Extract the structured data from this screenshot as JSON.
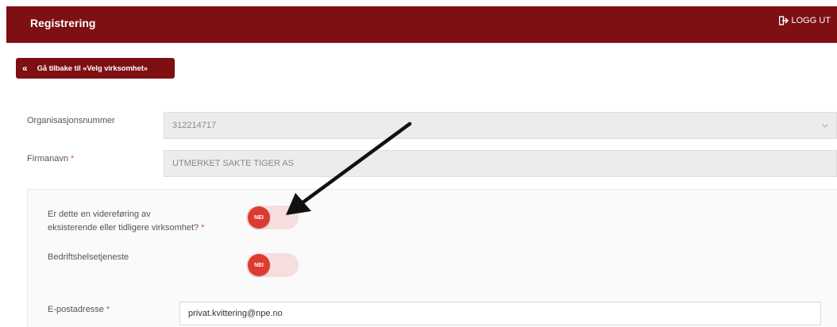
{
  "header": {
    "title": "Registrering",
    "logout_label": "LOGG UT"
  },
  "back_button": {
    "label": "Gå tilbake til «Velg virksomhet»"
  },
  "form": {
    "org_number": {
      "label": "Organisasjonsnummer",
      "value": "312214717"
    },
    "company_name": {
      "label": "Firmanavn",
      "required_mark": "*",
      "value": "UTMERKET SAKTE TIGER AS"
    },
    "continuation": {
      "label_line1": "Er dette en videreføring av",
      "label_line2": "eksisterende eller tidligere virksomhet?",
      "required_mark": "*",
      "toggle_text": "NEI"
    },
    "occupational_health": {
      "label": "Bedriftshelsetjeneste",
      "toggle_text": "NEI"
    },
    "email": {
      "label": "E-postadresse",
      "required_mark": "*",
      "value": "privat.kvittering@npe.no"
    }
  },
  "colors": {
    "brand": "#7e0f12",
    "toggle_knob": "#dd3b32",
    "toggle_track": "#f7dede",
    "required": "#d9534f"
  },
  "icons": {
    "logout": "logout-icon",
    "back": "double-chevron-left-icon",
    "dropdown": "chevron-down-icon",
    "annotation": "arrow-annotation-icon"
  }
}
